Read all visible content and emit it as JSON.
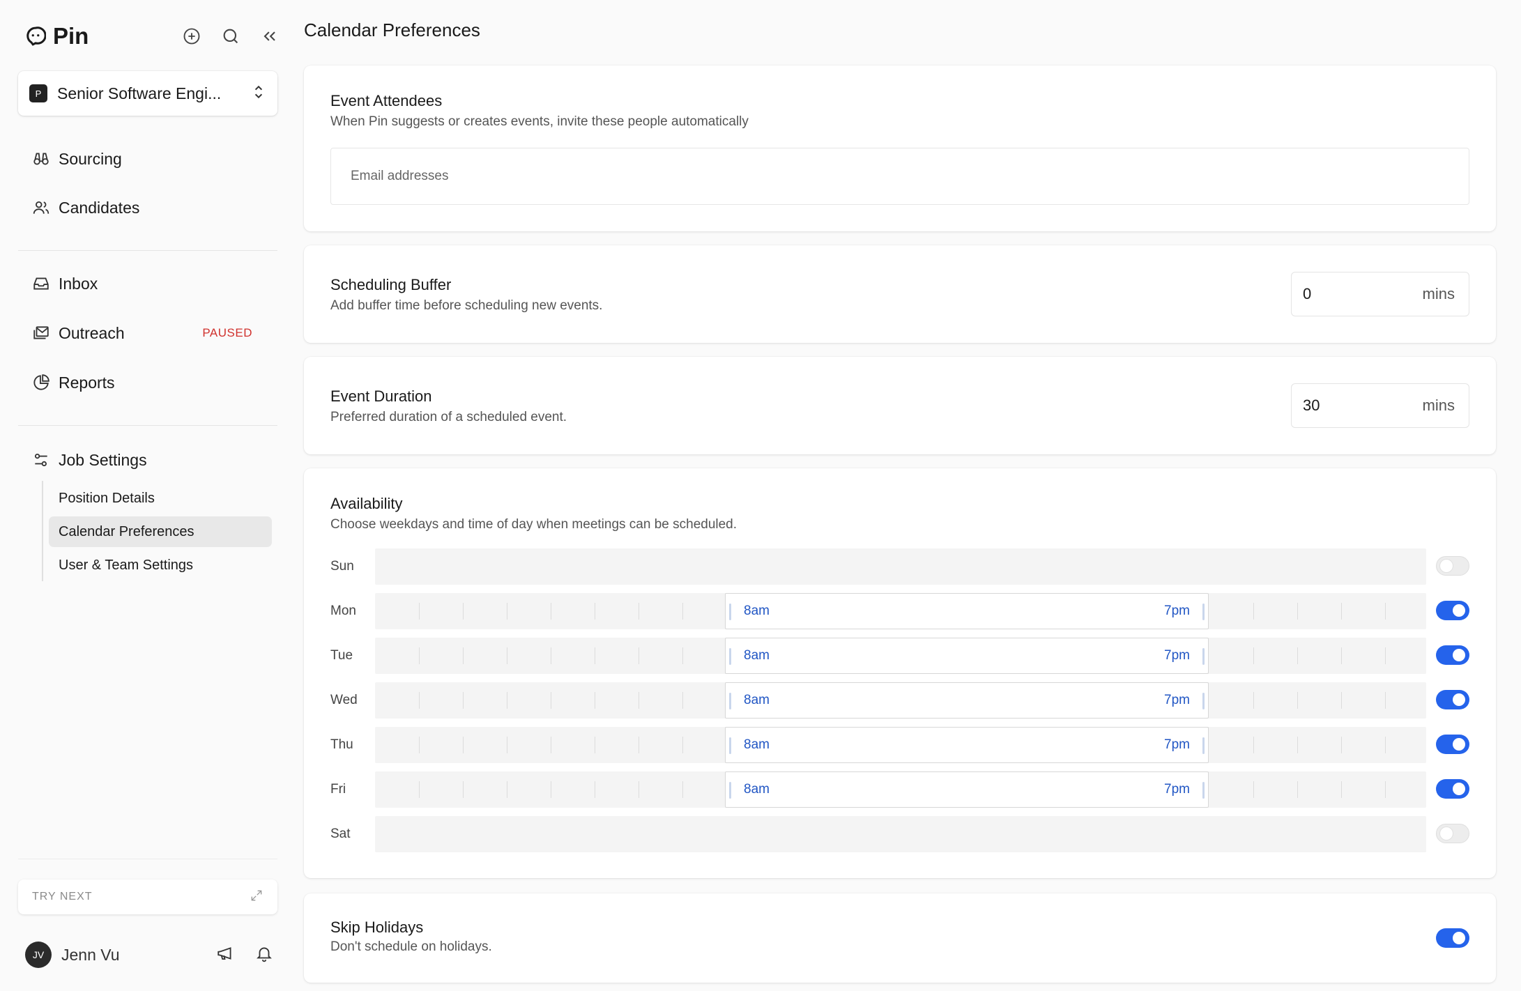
{
  "app": {
    "name": "Pin"
  },
  "job": {
    "badge": "P",
    "title": "Senior Software Engi..."
  },
  "nav": {
    "sourcing": "Sourcing",
    "candidates": "Candidates",
    "inbox": "Inbox",
    "outreach": "Outreach",
    "outreach_badge": "PAUSED",
    "reports": "Reports",
    "job_settings": "Job Settings"
  },
  "sub_nav": {
    "position_details": "Position Details",
    "calendar_preferences": "Calendar Preferences",
    "user_team_settings": "User & Team Settings"
  },
  "try_next": "TRY NEXT",
  "user": {
    "initials": "JV",
    "name": "Jenn Vu"
  },
  "page": {
    "title": "Calendar Preferences"
  },
  "attendees": {
    "title": "Event Attendees",
    "description": "When Pin suggests or creates events, invite these people automatically",
    "placeholder": "Email addresses"
  },
  "buffer": {
    "title": "Scheduling Buffer",
    "description": "Add buffer time before scheduling new events.",
    "value": "0",
    "unit": "mins"
  },
  "duration": {
    "title": "Event Duration",
    "description": "Preferred duration of a scheduled event.",
    "value": "30",
    "unit": "mins"
  },
  "availability": {
    "title": "Availability",
    "description": "Choose weekdays and time of day when meetings can be scheduled.",
    "days": [
      {
        "label": "Sun",
        "enabled": false,
        "start": "",
        "end": ""
      },
      {
        "label": "Mon",
        "enabled": true,
        "start": "8am",
        "end": "7pm"
      },
      {
        "label": "Tue",
        "enabled": true,
        "start": "8am",
        "end": "7pm"
      },
      {
        "label": "Wed",
        "enabled": true,
        "start": "8am",
        "end": "7pm"
      },
      {
        "label": "Thu",
        "enabled": true,
        "start": "8am",
        "end": "7pm"
      },
      {
        "label": "Fri",
        "enabled": true,
        "start": "8am",
        "end": "7pm"
      },
      {
        "label": "Sat",
        "enabled": false,
        "start": "",
        "end": ""
      }
    ]
  },
  "holidays": {
    "title": "Skip Holidays",
    "description": "Don't schedule on holidays.",
    "enabled": true
  },
  "colors": {
    "accent": "#2563eb",
    "time_text": "#2156c4",
    "paused": "#d0312d"
  }
}
